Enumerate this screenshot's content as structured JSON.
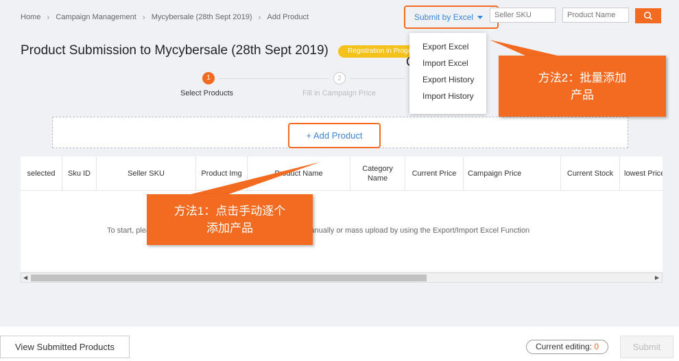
{
  "breadcrumb": {
    "items": [
      "Home",
      "Campaign Management",
      "Mycybersale (28th Sept 2019)",
      "Add Product"
    ]
  },
  "page_title": "Product Submission to Mycybersale (28th Sept 2019)",
  "status_badge": "Registration in Progress",
  "title_fragment": "C",
  "header": {
    "submit_excel_label": "Submit by Excel",
    "seller_sku_placeholder": "Seller SKU",
    "product_name_placeholder": "Product Name"
  },
  "excel_menu": {
    "items": [
      "Export Excel",
      "Import Excel",
      "Export History",
      "Import History"
    ]
  },
  "steps": [
    {
      "number": "1",
      "label": "Select Products"
    },
    {
      "number": "2",
      "label": "Fill in Campaign Price"
    }
  ],
  "add_product_label": "+ Add Product",
  "table": {
    "columns": [
      "selected",
      "Sku ID",
      "Seller SKU",
      "Product Img",
      "Product Name",
      "Category Name",
      "Current Price",
      "Campaign Price",
      "Current Stock",
      "lowest Price"
    ],
    "empty_message": "To start, please click \"Add Product\" button to add Products manually or mass upload by using the Export/Import Excel Function"
  },
  "footer": {
    "view_submitted_label": "View Submitted Products",
    "current_editing_label": "Current editing:",
    "current_editing_count": "0",
    "submit_label": "Submit"
  },
  "annotations": {
    "method2": "方法2：批量添加\n产品",
    "method1": "方法1：点击手动逐个\n添加产品"
  },
  "colors": {
    "accent": "#f26b21",
    "link": "#3a86d6",
    "badge": "#f4c21a"
  }
}
